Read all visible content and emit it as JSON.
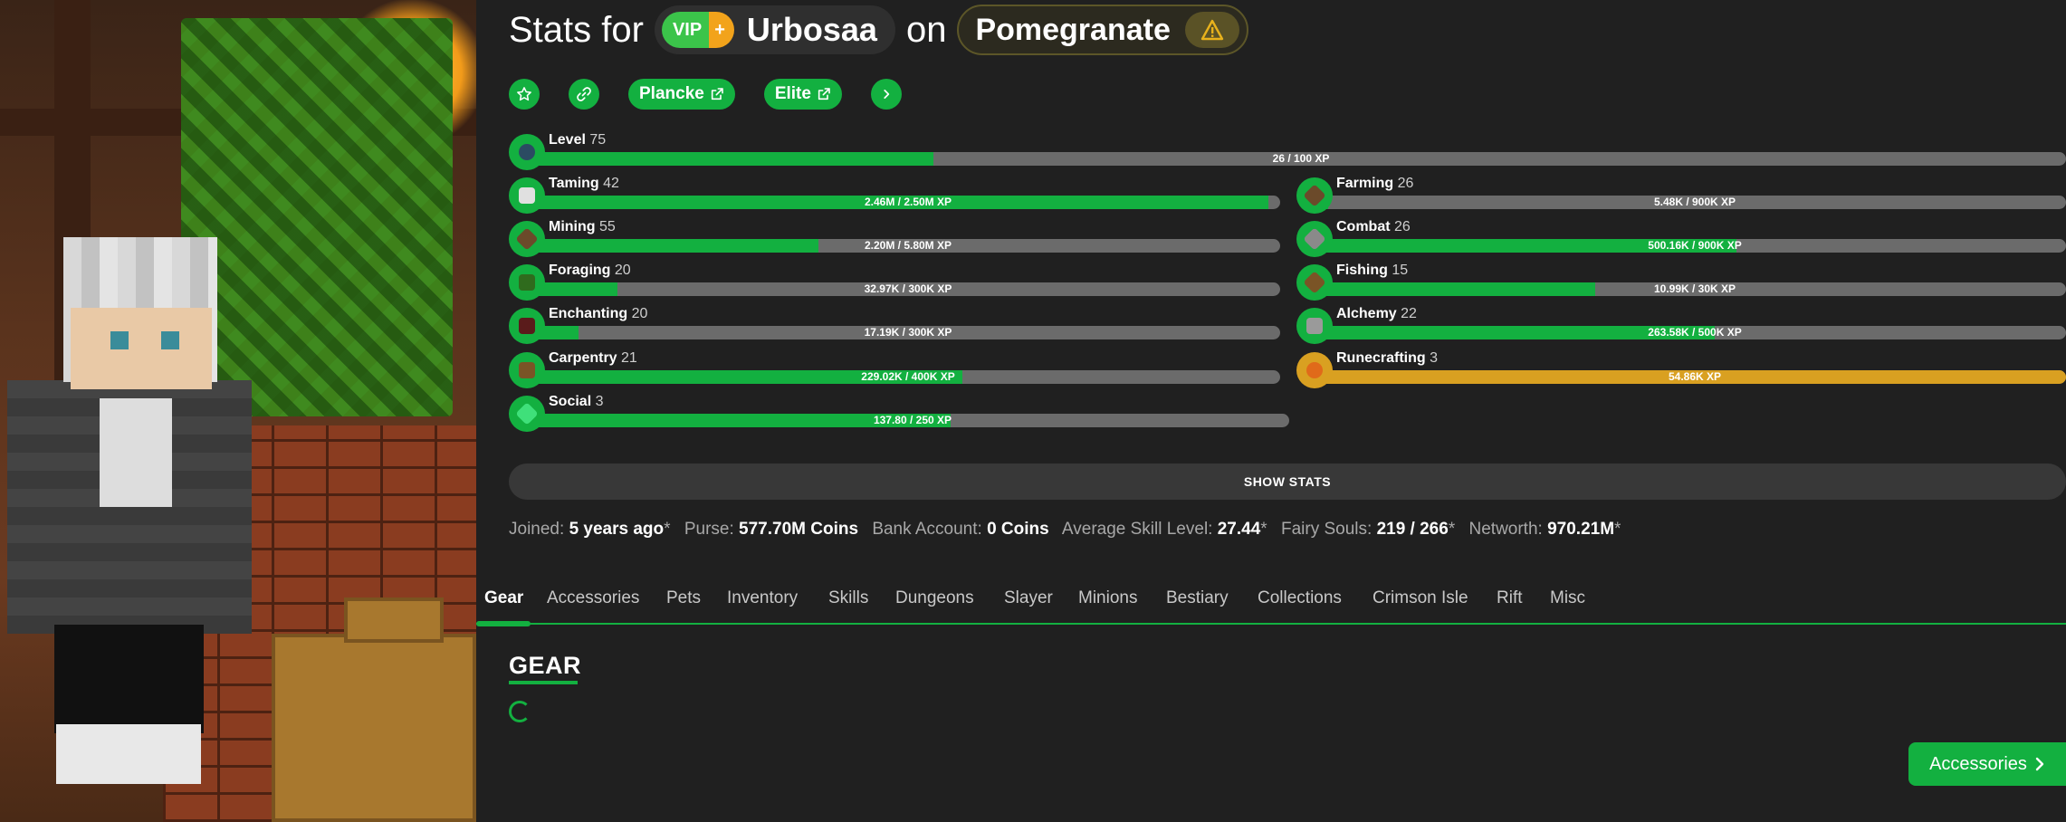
{
  "header": {
    "stats_for": "Stats for",
    "rank_vip": "VIP",
    "rank_plus": "+",
    "player_name": "Urbosaa",
    "on": "on",
    "profile_name": "Pomegranate",
    "warning_icon": "warning-triangle-icon"
  },
  "actions": {
    "favorite_icon": "star-icon",
    "link_icon": "link-icon",
    "plancke_label": "Plancke",
    "elite_label": "Elite",
    "more_icon": "chevron-right-icon"
  },
  "skills": {
    "level": {
      "name": "Level",
      "level": "75",
      "xp": "26 / 100 XP",
      "progress": 0.26,
      "icon": "level-icon"
    },
    "taming": {
      "name": "Taming",
      "level": "42",
      "xp": "2.46M / 2.50M XP",
      "progress": 0.984,
      "icon": "taming-icon"
    },
    "mining": {
      "name": "Mining",
      "level": "55",
      "xp": "2.20M / 5.80M XP",
      "progress": 0.38,
      "icon": "pickaxe-icon"
    },
    "foraging": {
      "name": "Foraging",
      "level": "20",
      "xp": "32.97K / 300K XP",
      "progress": 0.11,
      "icon": "sapling-icon"
    },
    "enchanting": {
      "name": "Enchanting",
      "level": "20",
      "xp": "17.19K / 300K XP",
      "progress": 0.057,
      "icon": "enchanting-table-icon"
    },
    "carpentry": {
      "name": "Carpentry",
      "level": "21",
      "xp": "229.02K / 400K XP",
      "progress": 0.573,
      "icon": "crafting-table-icon"
    },
    "social": {
      "name": "Social",
      "level": "3",
      "xp": "137.80 / 250 XP",
      "progress": 0.551,
      "icon": "emerald-icon"
    },
    "farming": {
      "name": "Farming",
      "level": "26",
      "xp": "5.48K / 900K XP",
      "progress": 0.006,
      "icon": "hoe-icon"
    },
    "combat": {
      "name": "Combat",
      "level": "26",
      "xp": "500.16K / 900K XP",
      "progress": 0.556,
      "icon": "sword-icon"
    },
    "fishing": {
      "name": "Fishing",
      "level": "15",
      "xp": "10.99K / 30K XP",
      "progress": 0.366,
      "icon": "fishing-rod-icon"
    },
    "alchemy": {
      "name": "Alchemy",
      "level": "22",
      "xp": "263.58K / 500K XP",
      "progress": 0.527,
      "icon": "brewing-stand-icon"
    },
    "runecrafting": {
      "name": "Runecrafting",
      "level": "3",
      "xp": "54.86K XP",
      "progress": 1.0,
      "maxed": true,
      "icon": "magma-cream-icon"
    }
  },
  "show_stats_label": "SHOW STATS",
  "info": {
    "joined_label": "Joined:",
    "joined_value": "5 years ago",
    "joined_mark": "*",
    "purse_label": "Purse:",
    "purse_value": "577.70M Coins",
    "bank_label": "Bank Account:",
    "bank_value": "0 Coins",
    "avg_skill_label": "Average Skill Level:",
    "avg_skill_value": "27.44",
    "avg_skill_mark": "*",
    "fairy_label": "Fairy Souls:",
    "fairy_value": "219 / 266",
    "fairy_mark": "*",
    "networth_label": "Networth:",
    "networth_value": "970.21M",
    "networth_mark": "*"
  },
  "tabs": [
    "Gear",
    "Accessories",
    "Pets",
    "Inventory",
    "Skills",
    "Dungeons",
    "Slayer",
    "Minions",
    "Bestiary",
    "Collections",
    "Crimson Isle",
    "Rift",
    "Misc"
  ],
  "active_tab": "Gear",
  "section": {
    "title": "GEAR"
  },
  "next_section": {
    "label": "Accessories"
  },
  "colors": {
    "accent": "#13b040",
    "maxed": "#d9a021",
    "bar_track": "#6b6b6b",
    "background": "#202020"
  }
}
